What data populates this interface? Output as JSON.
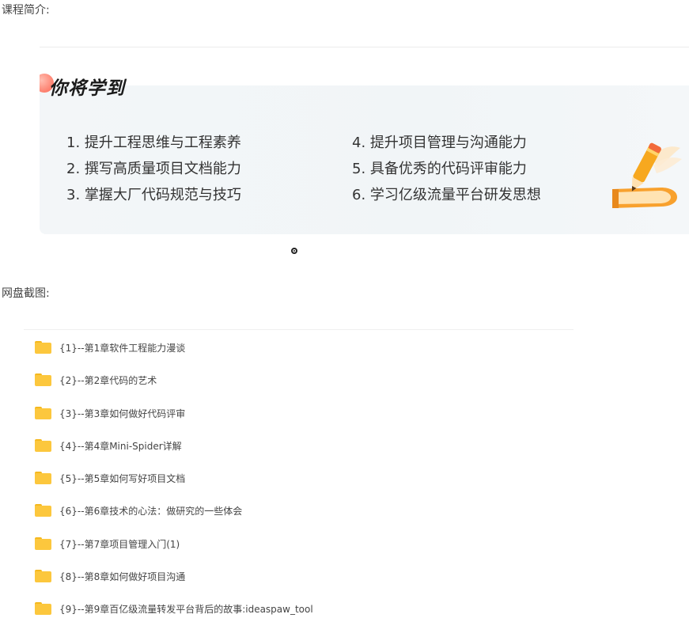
{
  "intro_label": "课程简介:",
  "banner": {
    "title": "你将学到",
    "skills": [
      "1. 提升工程思维与工程素养",
      "2. 撰写高质量项目文档能力",
      "3. 掌握大厂代码规范与技巧",
      "4. 提升项目管理与沟通能力",
      "5. 具备优秀的代码评审能力",
      "6. 学习亿级流量平台研发思想"
    ]
  },
  "screenshot_label": "网盘截图:",
  "folders": [
    "{1}--第1章软件工程能力漫谈",
    "{2}--第2章代码的艺术",
    "{3}--第3章如何做好代码评审",
    "{4}--第4章Mini-Spider详解",
    "{5}--第5章如何写好项目文档",
    "{6}--第6章技术的心法：做研究的一些体会",
    "{7}--第7章项目管理入门(1)",
    "{8}--第8章如何做好项目沟通",
    "{9}--第9章百亿级流量转发平台背后的故事:ideaspaw_tool"
  ],
  "colors": {
    "folder": "#fcc73d",
    "banner_bg": "#f3f6f8",
    "accent": "#f5a623"
  }
}
